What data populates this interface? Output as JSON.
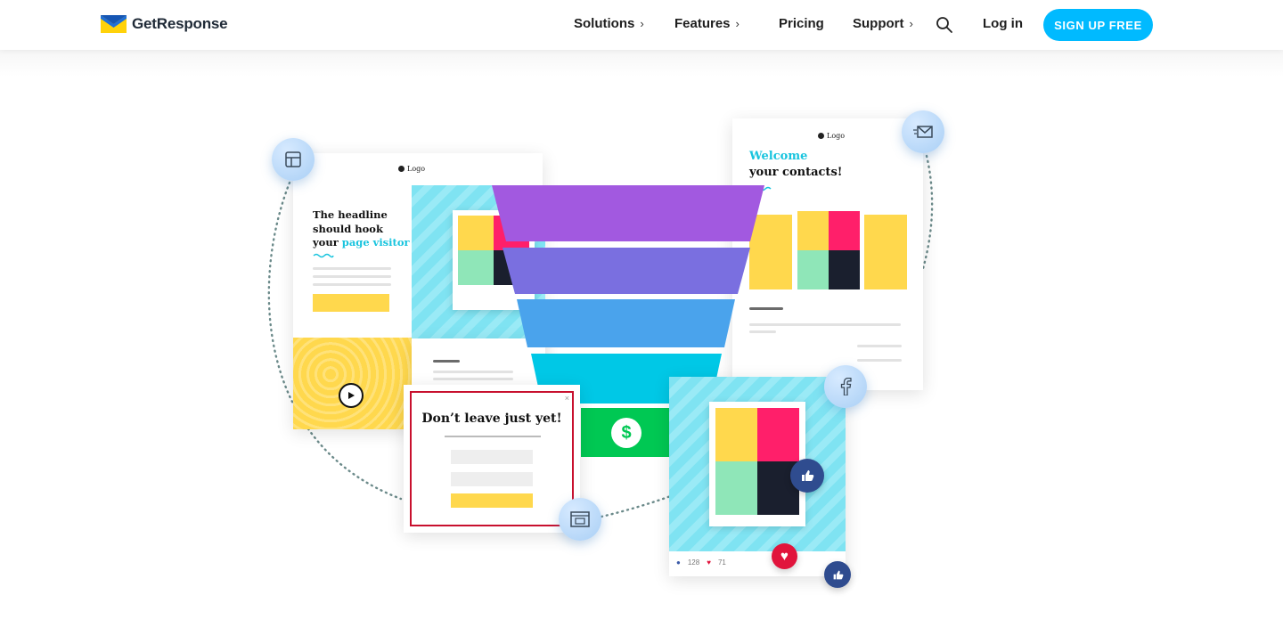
{
  "header": {
    "brand": "GetResponse",
    "nav": [
      {
        "label": "Solutions",
        "chevron": "›"
      },
      {
        "label": "Features",
        "chevron": "›"
      },
      {
        "label": "Pricing",
        "chevron": ""
      },
      {
        "label": "Support",
        "chevron": "›"
      }
    ],
    "login": "Log in",
    "signup": "SIGN UP FREE"
  },
  "illustration": {
    "landing": {
      "logo": "Logo",
      "headline_1": "The headline",
      "headline_2": "should hook",
      "headline_3": "your ",
      "headline_highlight": "page visitor"
    },
    "email": {
      "logo": "Logo",
      "title_1": "Welcome",
      "title_2": "your contacts!"
    },
    "popup": {
      "title": "Don’t leave just yet!",
      "close": "×"
    },
    "social": {
      "likes": "128",
      "hearts": "71"
    },
    "funnel_money": "$",
    "colors": {
      "accent": "#00baff",
      "purple": "#a259e0",
      "violet": "#7a6fe0",
      "blue": "#4aa3ec",
      "cyan": "#00c8e6",
      "green": "#00c853",
      "yellow": "#ffd84d"
    }
  }
}
